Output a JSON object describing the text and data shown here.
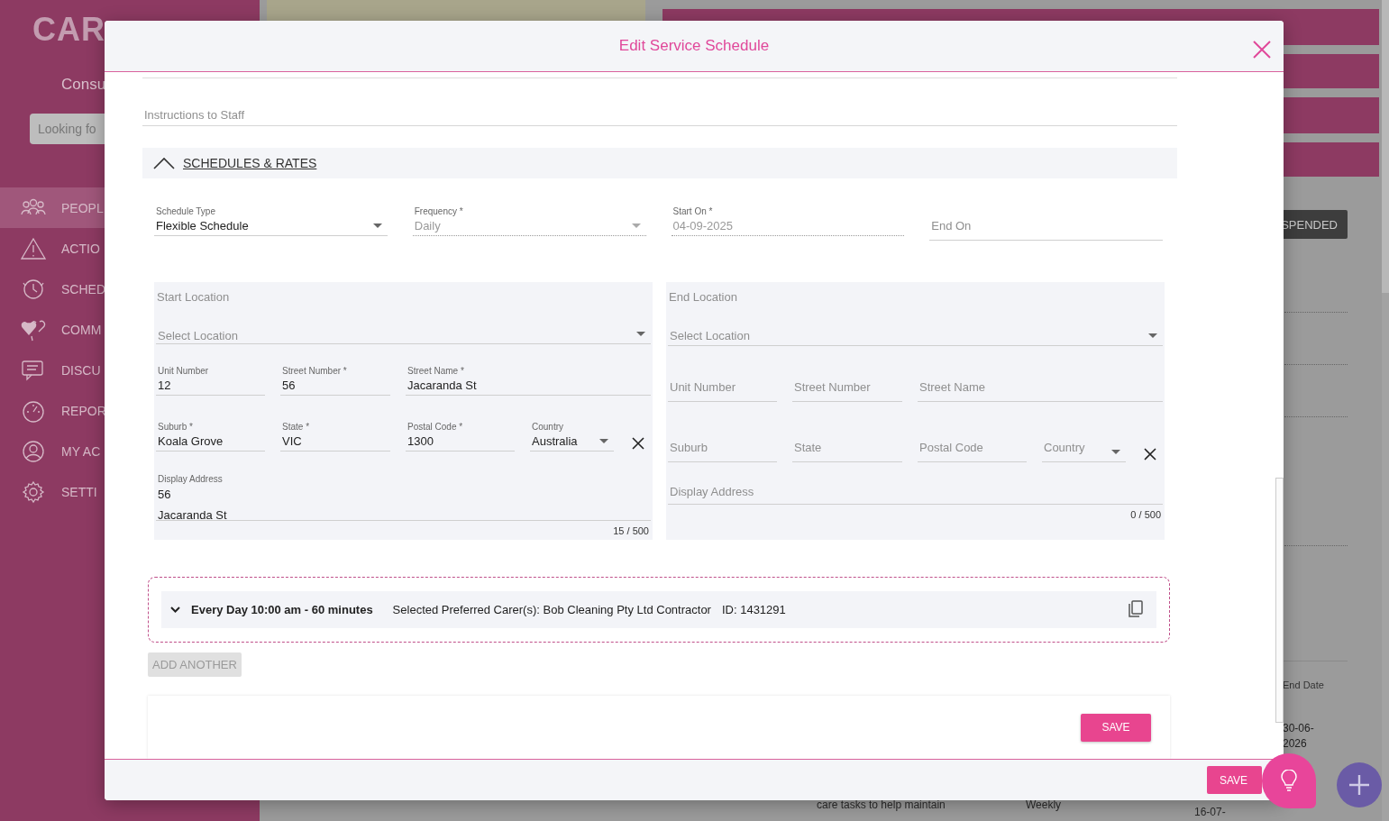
{
  "background": {
    "logo": "CAR",
    "account_text": "Consu",
    "search": {
      "placeholder": "Looking fo"
    },
    "nav": [
      {
        "label": "PEOPL",
        "selected": true
      },
      {
        "label": "ACTIO",
        "selected": false
      },
      {
        "label": "SCHED",
        "selected": false
      },
      {
        "label": "COMM",
        "selected": false
      },
      {
        "label": "DISCU",
        "selected": false
      },
      {
        "label": "REPOR",
        "selected": false
      },
      {
        "label": "MY AC",
        "selected": false
      },
      {
        "label": "SETTI",
        "selected": false
      }
    ],
    "status_button": "SPENDED",
    "table": {
      "column_header": "End Date",
      "end_date": "30-06-2026",
      "next_row": [
        "care tasks to help maintain",
        "Weekly",
        "16-07-"
      ]
    }
  },
  "modal": {
    "title": "Edit Service Schedule",
    "instructions_field": {
      "placeholder": "Instructions to Staff"
    },
    "section": {
      "title": "SCHEDULES & RATES",
      "expanded": true
    },
    "schedule_fields": [
      {
        "kind": "select",
        "label": "Schedule Type",
        "value": "Flexible Schedule",
        "disabled": false
      },
      {
        "kind": "select",
        "label": "Frequency *",
        "value": "Daily",
        "disabled": true
      },
      {
        "kind": "text",
        "label": "Start On *",
        "value": "04-09-2025",
        "disabled": true
      },
      {
        "kind": "text",
        "label": "End On",
        "disabled": false
      }
    ],
    "locations": [
      {
        "title": "Start Location",
        "select": {
          "placeholder": "Select Location"
        },
        "fields": [
          {
            "kind": "text",
            "label": "Unit Number",
            "value": "12"
          },
          {
            "kind": "text",
            "label": "Street Number *",
            "value": "56"
          },
          {
            "kind": "text",
            "label": "Street Name *",
            "value": "Jacaranda St"
          },
          {
            "kind": "text",
            "label": "Suburb *",
            "value": "Koala Grove"
          },
          {
            "kind": "text",
            "label": "State *",
            "value": "VIC"
          },
          {
            "kind": "text",
            "label": "Postal Code *",
            "value": "1300"
          },
          {
            "kind": "select",
            "label": "Country",
            "value": "Australia"
          }
        ],
        "display_address": {
          "label": "Display Address",
          "value": "56\nJacaranda St"
        },
        "counter": "15 / 500"
      },
      {
        "title": "End Location",
        "select": {
          "placeholder": "Select Location"
        },
        "fields": [
          {
            "kind": "text",
            "label": "Unit Number"
          },
          {
            "kind": "text",
            "label": "Street Number"
          },
          {
            "kind": "text",
            "label": "Street Name"
          },
          {
            "kind": "text",
            "label": "Suburb"
          },
          {
            "kind": "text",
            "label": "State"
          },
          {
            "kind": "text",
            "label": "Postal Code"
          },
          {
            "kind": "select",
            "label": "Country"
          }
        ],
        "display_address": {
          "label": "Display Address"
        },
        "counter": "0 / 500"
      }
    ],
    "schedules": [
      {
        "summary": "Every Day 10:00 am - 60 minutes",
        "carers": "Selected Preferred Carer(s): Bob Cleaning Pty Ltd Contractor",
        "id": "ID: 1431291",
        "expanded": false
      }
    ],
    "add_button": {
      "label": "ADD ANOTHER",
      "disabled": true
    },
    "save_button": "SAVE",
    "footer_save_button": "SAVE"
  }
}
